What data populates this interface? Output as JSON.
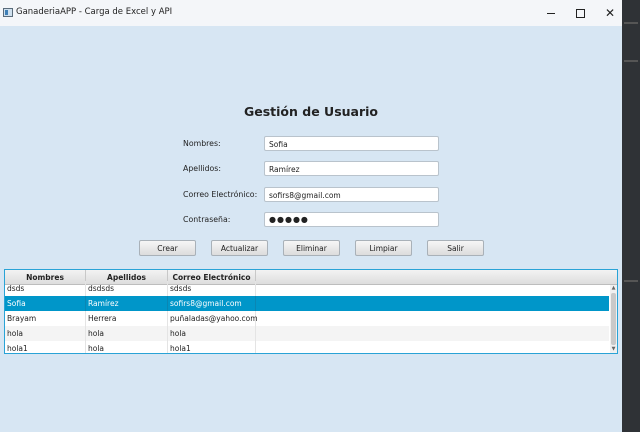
{
  "window": {
    "title": "GanaderiaAPP - Carga de Excel y API",
    "controls": {
      "minimize": "minimize-icon",
      "maximize": "maximize-icon",
      "close": "✕"
    }
  },
  "form": {
    "heading": "Gestión de Usuario",
    "fields": [
      {
        "label": "Nombres:",
        "value": "Sofia"
      },
      {
        "label": "Apellidos:",
        "value": "Ramírez"
      },
      {
        "label": "Correo Electrónico:",
        "value": "sofirs8@gmail.com"
      },
      {
        "label": "Contraseña:",
        "value": "●●●●●"
      }
    ],
    "buttons": [
      "Crear",
      "Actualizar",
      "Eliminar",
      "Limpiar",
      "Salir"
    ]
  },
  "table": {
    "columns": [
      "Nombres",
      "Apellidos",
      "Correo Electrónico"
    ],
    "rows": [
      [
        "dsds",
        "dsdsds",
        "sdsds"
      ],
      [
        "Sofia",
        "Ramírez",
        "sofirs8@gmail.com"
      ],
      [
        "Brayam",
        "Herrera",
        "puñaladas@yahoo.com"
      ],
      [
        "hola",
        "hola",
        "hola"
      ],
      [
        "hola1",
        "hola",
        "hola1"
      ]
    ],
    "selected_row": 1
  }
}
